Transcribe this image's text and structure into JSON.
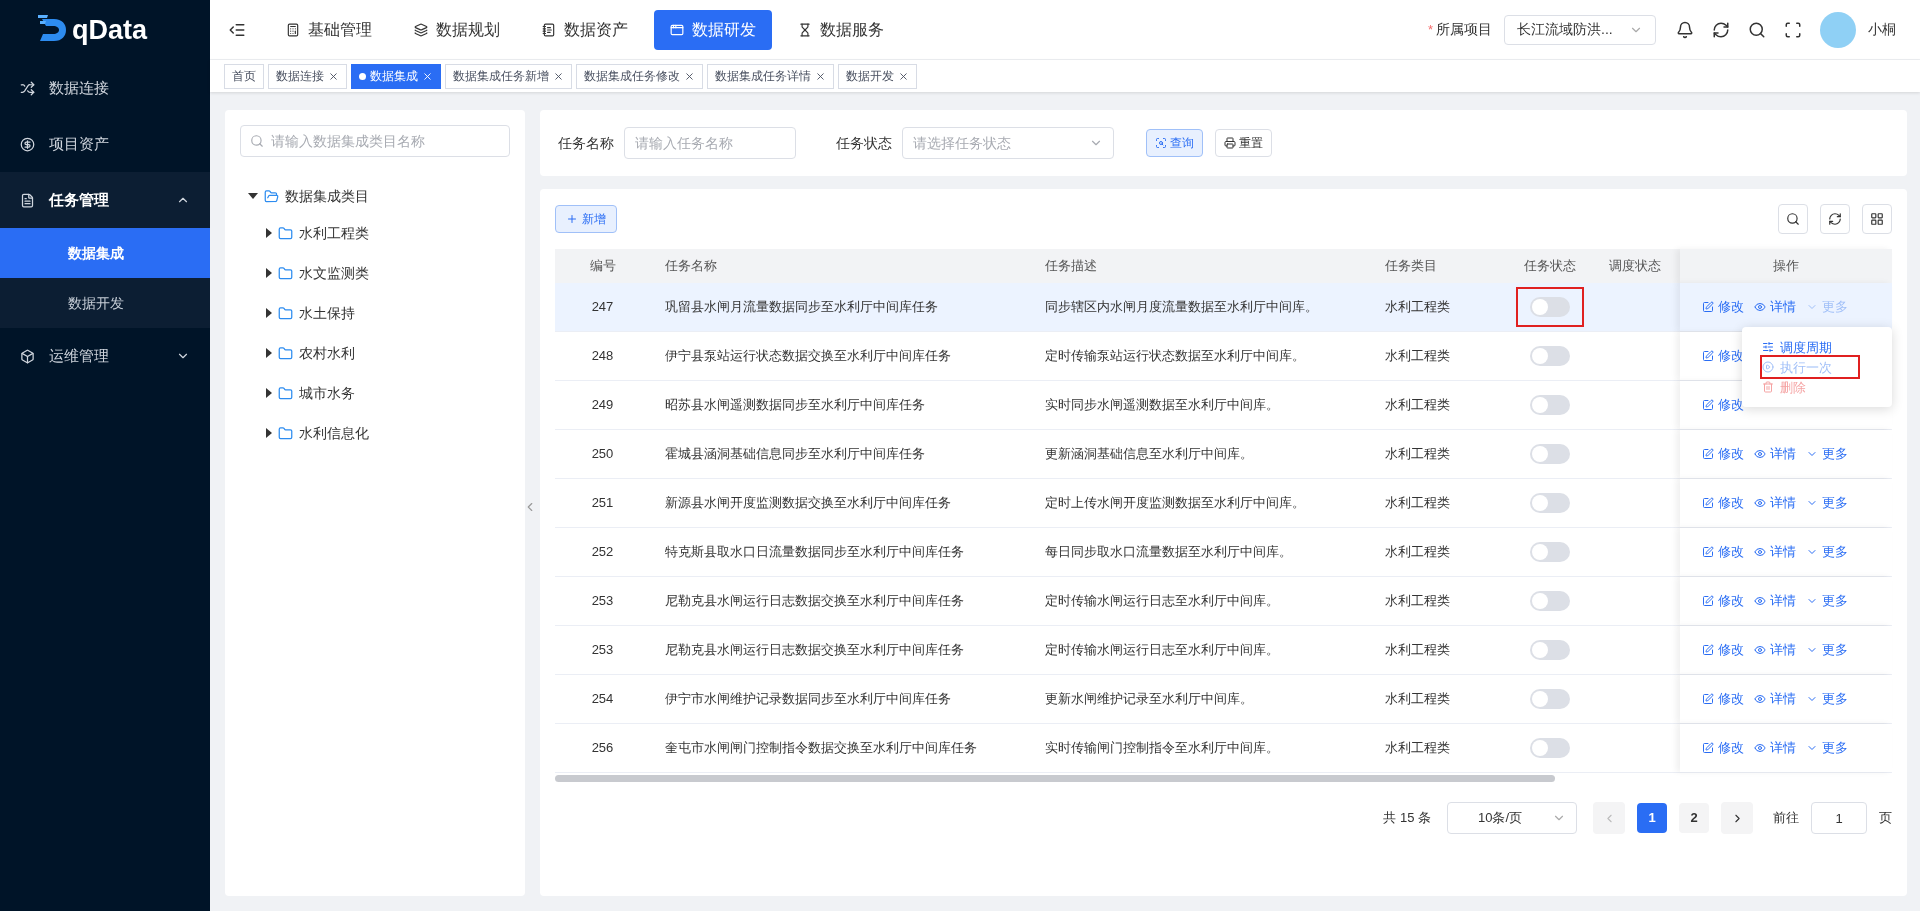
{
  "logo": {
    "text": "qData"
  },
  "sidebar": {
    "items": [
      {
        "label": "数据连接",
        "expanded": false
      },
      {
        "label": "项目资产",
        "expanded": false
      },
      {
        "label": "任务管理",
        "expanded": true,
        "children": [
          {
            "label": "数据集成",
            "selected": true
          },
          {
            "label": "数据开发",
            "selected": false
          }
        ]
      },
      {
        "label": "运维管理",
        "expanded": false
      }
    ]
  },
  "top_nav": [
    {
      "label": "基础管理",
      "selected": false
    },
    {
      "label": "数据规划",
      "selected": false
    },
    {
      "label": "数据资产",
      "selected": false
    },
    {
      "label": "数据研发",
      "selected": true
    },
    {
      "label": "数据服务",
      "selected": false
    }
  ],
  "header": {
    "project_label": "所属项目",
    "required_mark": "*",
    "project_value": "长江流域防洪...",
    "user_name": "小桐"
  },
  "page_tabs": [
    {
      "label": "首页",
      "selected": false,
      "closable": false
    },
    {
      "label": "数据连接",
      "selected": false,
      "closable": true
    },
    {
      "label": "数据集成",
      "selected": true,
      "closable": true
    },
    {
      "label": "数据集成任务新增",
      "selected": false,
      "closable": true
    },
    {
      "label": "数据集成任务修改",
      "selected": false,
      "closable": true
    },
    {
      "label": "数据集成任务详情",
      "selected": false,
      "closable": true
    },
    {
      "label": "数据开发",
      "selected": false,
      "closable": true
    }
  ],
  "tree": {
    "search_placeholder": "请输入数据集成类目名称",
    "root": {
      "label": "数据集成类目",
      "expanded": true,
      "children": [
        {
          "label": "水利工程类",
          "expanded": false
        },
        {
          "label": "水文监测类",
          "expanded": false
        },
        {
          "label": "水土保持",
          "expanded": false
        },
        {
          "label": "农村水利",
          "expanded": false
        },
        {
          "label": "城市水务",
          "expanded": false
        },
        {
          "label": "水利信息化",
          "expanded": false
        }
      ]
    }
  },
  "filters": {
    "name_label": "任务名称",
    "name_placeholder": "请输入任务名称",
    "status_label": "任务状态",
    "status_placeholder": "请选择任务状态",
    "query_button": "查询",
    "reset_button": "重置"
  },
  "add_button": "新增",
  "table": {
    "columns": [
      "编号",
      "任务名称",
      "任务描述",
      "任务类目",
      "任务状态",
      "调度状态",
      "操作"
    ],
    "rows": [
      {
        "id": "247",
        "name": "巩留县水闸月流量数据同步至水利厅中间库任务",
        "description": "同步辖区内水闸月度流量数据至水利厅中间库。",
        "category": "水利工程类",
        "status_on": false,
        "status_marked": true,
        "selected": true,
        "more_expanded": true,
        "edit": "修改",
        "detail": "详情",
        "more": "更多"
      },
      {
        "id": "248",
        "name": "伊宁县泵站运行状态数据交换至水利厅中间库任务",
        "description": "定时传输泵站运行状态数据至水利厅中间库。",
        "category": "水利工程类",
        "status_on": false,
        "status_marked": false,
        "selected": false,
        "more_expanded": false,
        "edit": "修改"
      },
      {
        "id": "249",
        "name": "昭苏县水闸遥测数据同步至水利厅中间库任务",
        "description": "实时同步水闸遥测数据至水利厅中间库。",
        "category": "水利工程类",
        "status_on": false,
        "status_marked": false,
        "selected": false,
        "more_expanded": false,
        "edit": "修改"
      },
      {
        "id": "250",
        "name": "霍城县涵洞基础信息同步至水利厅中间库任务",
        "description": "更新涵洞基础信息至水利厅中间库。",
        "category": "水利工程类",
        "status_on": false,
        "status_marked": false,
        "selected": false,
        "more_expanded": false,
        "edit": "修改",
        "detail": "详情",
        "more": "更多"
      },
      {
        "id": "251",
        "name": "新源县水闸开度监测数据交换至水利厅中间库任务",
        "description": "定时上传水闸开度监测数据至水利厅中间库。",
        "category": "水利工程类",
        "status_on": false,
        "status_marked": false,
        "selected": false,
        "more_expanded": false,
        "edit": "修改",
        "detail": "详情",
        "more": "更多"
      },
      {
        "id": "252",
        "name": "特克斯县取水口日流量数据同步至水利厅中间库任务",
        "description": "每日同步取水口流量数据至水利厅中间库。",
        "category": "水利工程类",
        "status_on": false,
        "status_marked": false,
        "selected": false,
        "more_expanded": false,
        "edit": "修改",
        "detail": "详情",
        "more": "更多"
      },
      {
        "id": "253",
        "name": "尼勒克县水闸运行日志数据交换至水利厅中间库任务",
        "description": "定时传输水闸运行日志至水利厅中间库。",
        "category": "水利工程类",
        "status_on": false,
        "status_marked": false,
        "selected": false,
        "more_expanded": false,
        "edit": "修改",
        "detail": "详情",
        "more": "更多"
      },
      {
        "id": "253",
        "name": "尼勒克县水闸运行日志数据交换至水利厅中间库任务",
        "description": "定时传输水闸运行日志至水利厅中间库。",
        "category": "水利工程类",
        "status_on": false,
        "status_marked": false,
        "selected": false,
        "more_expanded": false,
        "edit": "修改",
        "detail": "详情",
        "more": "更多"
      },
      {
        "id": "254",
        "name": "伊宁市水闸维护记录数据同步至水利厅中间库任务",
        "description": "更新水闸维护记录至水利厅中间库。",
        "category": "水利工程类",
        "status_on": false,
        "status_marked": false,
        "selected": false,
        "more_expanded": false,
        "edit": "修改",
        "detail": "详情",
        "more": "更多"
      },
      {
        "id": "256",
        "name": "奎屯市水闸闸门控制指令数据交换至水利厅中间库任务",
        "description": "实时传输闸门控制指令至水利厅中间库。",
        "category": "水利工程类",
        "status_on": false,
        "status_marked": false,
        "selected": false,
        "more_expanded": false,
        "edit": "修改",
        "detail": "详情",
        "more": "更多"
      }
    ]
  },
  "more_menu": [
    {
      "label": "调度周期",
      "kind": "schedule",
      "disabled": false,
      "marked": false
    },
    {
      "label": "执行一次",
      "kind": "run",
      "disabled": true,
      "marked": true
    },
    {
      "label": "删除",
      "kind": "delete",
      "disabled": true,
      "marked": false
    }
  ],
  "pagination": {
    "total": "共 15 条",
    "page_size": "10条/页",
    "pages": [
      {
        "label": "1",
        "selected": true
      },
      {
        "label": "2",
        "selected": false
      }
    ],
    "goto_label": "前往",
    "goto_value": "1",
    "goto_suffix": "页"
  }
}
